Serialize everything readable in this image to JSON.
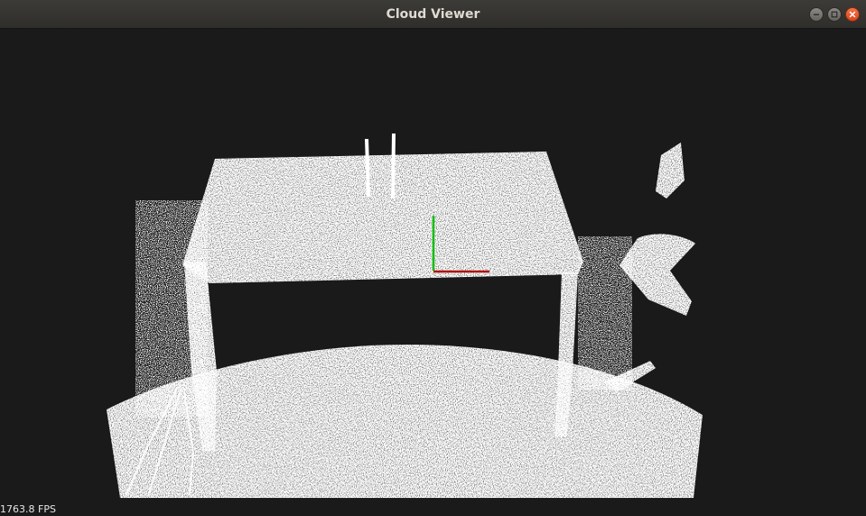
{
  "window": {
    "title": "Cloud Viewer",
    "controls": {
      "minimize_icon": "minimize-icon",
      "maximize_icon": "maximize-icon",
      "close_icon": "close-icon"
    }
  },
  "viewer": {
    "background_color": "#1a1a1a",
    "point_color": "#ffffff",
    "fps_label": "1763.8 FPS",
    "axes": {
      "x_color": "#b01010",
      "y_color": "#10c010"
    }
  }
}
